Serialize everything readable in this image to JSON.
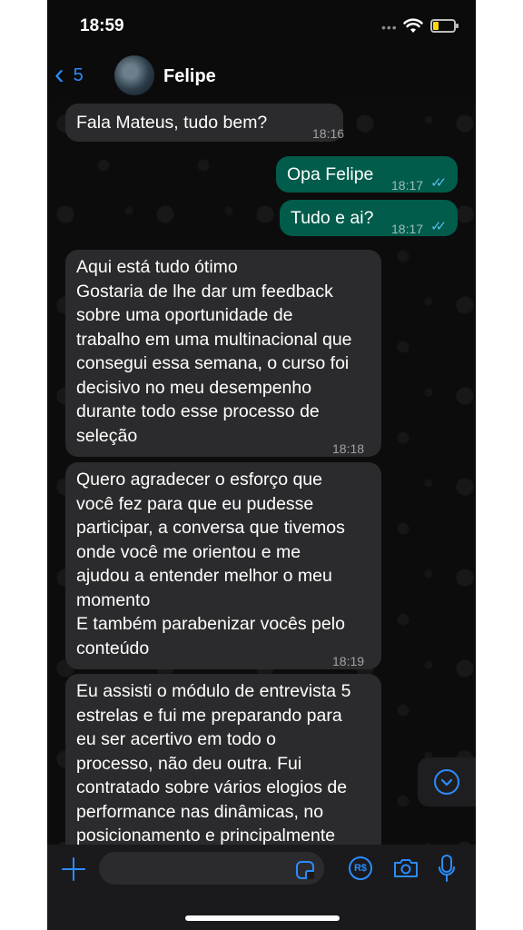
{
  "status_bar": {
    "time": "18:59",
    "dots": "•••"
  },
  "header": {
    "back_count": "5",
    "contact_name": "Felipe"
  },
  "messages": [
    {
      "direction": "in",
      "text": "Fala Mateus, tudo bem?",
      "time": "18:16"
    },
    {
      "direction": "out",
      "text": "Opa Felipe",
      "time": "18:17",
      "ticks": "✓✓"
    },
    {
      "direction": "out",
      "text": "Tudo e ai?",
      "time": "18:17",
      "ticks": "✓✓"
    },
    {
      "direction": "in",
      "text": "Aqui está tudo ótimo\nGostaria de lhe dar um feedback\nsobre uma oportunidade de\ntrabalho em uma multinacional que\nconsegui essa semana, o curso foi\ndecisivo no meu desempenho\ndurante todo esse processo de\nseleção",
      "time": "18:18"
    },
    {
      "direction": "in",
      "text": "Quero agradecer o esforço que\nvocê fez para que eu pudesse\nparticipar, a conversa que tivemos\nonde você me orientou e me\najudou a entender melhor o meu\nmomento\nE também parabenizar vocês pelo\nconteúdo",
      "time": "18:19"
    },
    {
      "direction": "in",
      "text": "Eu assisti o módulo de entrevista 5\nestrelas e fui me preparando para\neu ser acertivo em todo o\nprocesso, não deu outra. Fui\ncontratado sobre vários elogios de\nperformance nas dinâmicas, no\nposicionamento e principalmente",
      "time": ""
    }
  ],
  "composer": {
    "placeholder": "",
    "pay_label": "R$"
  },
  "colors": {
    "accent": "#2a8cff",
    "incoming_bubble": "#2b2b2d",
    "outgoing_bubble": "#015c4b",
    "read_ticks": "#53bdeb"
  }
}
